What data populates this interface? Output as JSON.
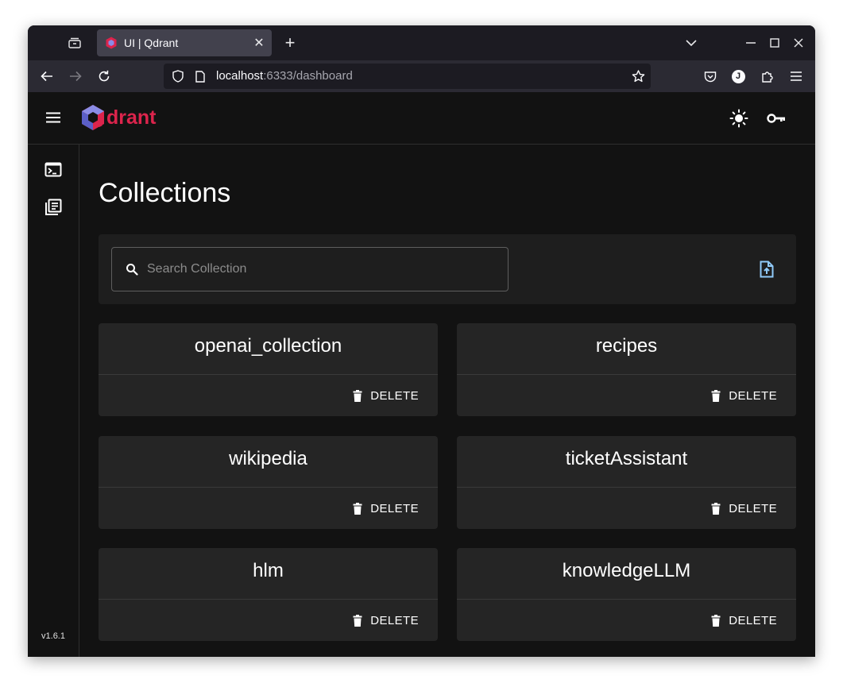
{
  "browser": {
    "tab_title": "UI | Qdrant",
    "url_host": "localhost",
    "url_rest": ":6333/dashboard",
    "avatar_letter": "J"
  },
  "app": {
    "logo_text": "drant",
    "brand_color": "#dc244c",
    "version": "v1.6.1"
  },
  "main": {
    "page_title": "Collections",
    "search_placeholder": "Search Collection",
    "delete_label": "DELETE",
    "collections": [
      {
        "name": "openai_collection"
      },
      {
        "name": "recipes"
      },
      {
        "name": "wikipedia"
      },
      {
        "name": "ticketAssistant"
      },
      {
        "name": "hlm"
      },
      {
        "name": "knowledgeLLM"
      }
    ]
  },
  "icons": {
    "upload": "file-upload-icon",
    "theme": "sun-icon",
    "api_key": "key-icon",
    "console": "terminal-icon",
    "collections": "library-icon"
  },
  "colors": {
    "accent_blue": "#90caf9",
    "background": "#121212",
    "card": "#252525"
  }
}
